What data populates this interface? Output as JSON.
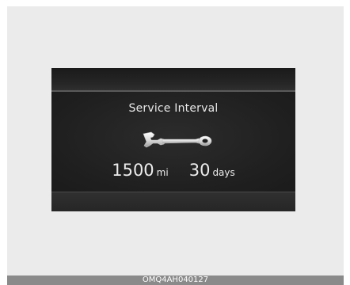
{
  "screen": {
    "title": "Service Interval",
    "icon": "wrench-icon",
    "distance_value": "1500",
    "distance_unit": "mi",
    "days_value": "30",
    "days_unit": "days"
  },
  "caption": {
    "code": "OMQ4AH040127"
  },
  "colors": {
    "display_background": "#1d1d1d",
    "text": "#e8e8e8",
    "caption_bar": "#8a8a8a"
  }
}
